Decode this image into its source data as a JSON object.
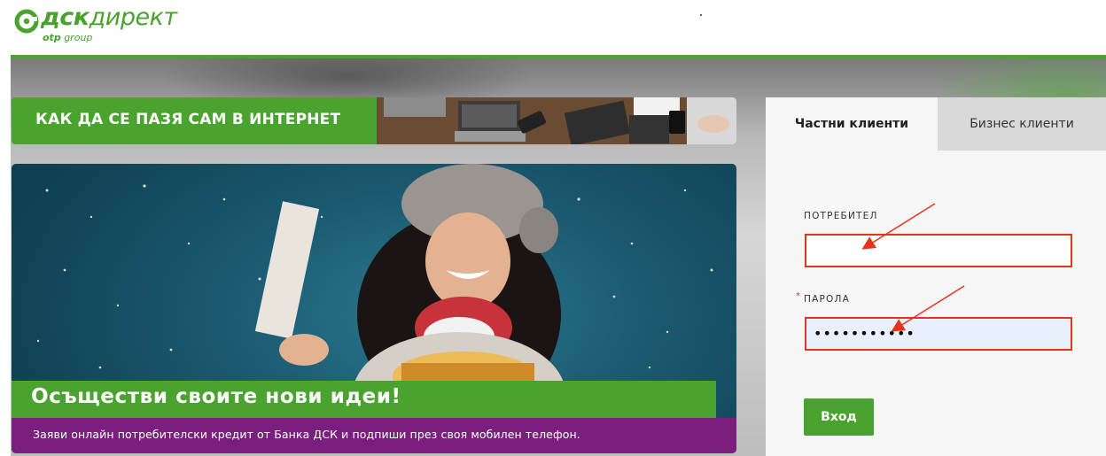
{
  "header": {
    "brand_main": "дск",
    "brand_rest": "директ",
    "brand_sub_bold": "otp",
    "brand_sub_rest": "group"
  },
  "banner": {
    "label": "КАК ДА СЕ ПАЗЯ САМ В ИНТЕРНЕТ"
  },
  "promo": {
    "title": "Осъществи своите нови идеи!",
    "subtitle": "Заяви онлайн потребителски кредит от Банка ДСК и подпиши през своя мобилен телефон."
  },
  "login": {
    "tabs": [
      {
        "label": "Частни клиенти",
        "active": true
      },
      {
        "label": "Бизнес клиенти",
        "active": false
      }
    ],
    "username_label": "ПОТРЕБИТЕЛ",
    "username_value": "",
    "password_label": "ПАРОЛА",
    "password_value": "•••••••••••",
    "required_mark": "*",
    "submit_label": "Вход"
  },
  "colors": {
    "brand_green": "#4aa22f",
    "promo_purple": "#7a1f7e",
    "highlight_red": "#e5341c"
  },
  "icons": [
    "dsk-logo-icon",
    "annotation-arrow-icon"
  ]
}
